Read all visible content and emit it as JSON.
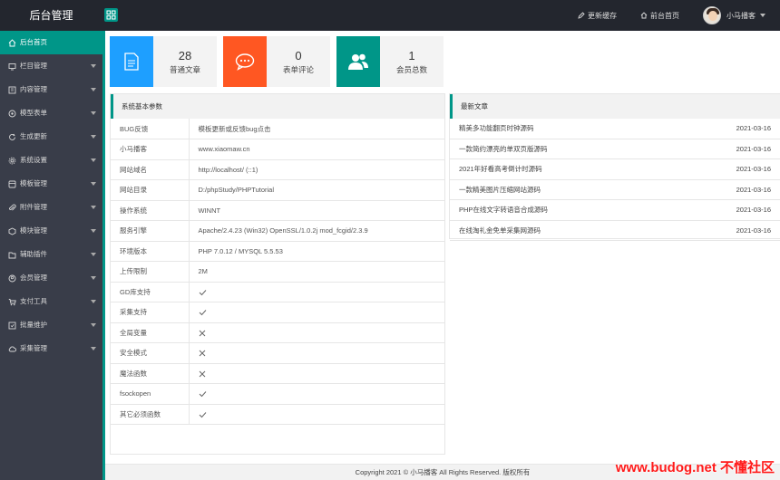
{
  "header": {
    "title": "后台管理",
    "update_cache": "更新缓存",
    "front_page": "前台首页",
    "username": "小马播客"
  },
  "sidebar": {
    "items": [
      {
        "label": "后台首页",
        "icon": "home-icon",
        "active": true
      },
      {
        "label": "栏目管理",
        "icon": "monitor-icon"
      },
      {
        "label": "内容管理",
        "icon": "content-icon"
      },
      {
        "label": "模型表单",
        "icon": "form-icon"
      },
      {
        "label": "生成更新",
        "icon": "refresh-icon"
      },
      {
        "label": "系统设置",
        "icon": "gear-icon"
      },
      {
        "label": "模板管理",
        "icon": "template-icon"
      },
      {
        "label": "附件管理",
        "icon": "attachment-icon"
      },
      {
        "label": "模块管理",
        "icon": "module-icon"
      },
      {
        "label": "辅助插件",
        "icon": "plugin-icon"
      },
      {
        "label": "会员管理",
        "icon": "member-icon"
      },
      {
        "label": "支付工具",
        "icon": "cart-icon"
      },
      {
        "label": "批量维护",
        "icon": "batch-icon"
      },
      {
        "label": "采集管理",
        "icon": "cloud-icon"
      }
    ]
  },
  "stats": [
    {
      "num": "28",
      "label": "普通文章",
      "color": "#1e9fff",
      "icon": "document-icon"
    },
    {
      "num": "0",
      "label": "表单评论",
      "color": "#ff5722",
      "icon": "chat-icon"
    },
    {
      "num": "1",
      "label": "会员总数",
      "color": "#009688",
      "icon": "users-icon"
    }
  ],
  "system": {
    "title": "系统基本参数",
    "rows": [
      {
        "k": "BUG反馈",
        "v": "模板更新或反馈bug点击",
        "t": "text"
      },
      {
        "k": "小马播客",
        "v": "www.xiaomaw.cn",
        "t": "text"
      },
      {
        "k": "网站域名",
        "v": "http://localhost/ (::1)",
        "t": "text"
      },
      {
        "k": "网站目录",
        "v": "D:/phpStudy/PHPTutorial",
        "t": "text"
      },
      {
        "k": "操作系统",
        "v": "WINNT",
        "t": "text"
      },
      {
        "k": "服务引擎",
        "v": "Apache/2.4.23 (Win32) OpenSSL/1.0.2j mod_fcgid/2.3.9",
        "t": "text"
      },
      {
        "k": "环境版本",
        "v": "PHP 7.0.12 / MYSQL 5.5.53",
        "t": "text"
      },
      {
        "k": "上传限制",
        "v": "2M",
        "t": "text"
      },
      {
        "k": "GD库支持",
        "v": "",
        "t": "check"
      },
      {
        "k": "采集支持",
        "v": "",
        "t": "check"
      },
      {
        "k": "全局变量",
        "v": "",
        "t": "cross"
      },
      {
        "k": "安全模式",
        "v": "",
        "t": "cross"
      },
      {
        "k": "魔法函数",
        "v": "",
        "t": "cross"
      },
      {
        "k": "fsockopen",
        "v": "",
        "t": "check"
      },
      {
        "k": "其它必须函数",
        "v": "",
        "t": "check"
      }
    ]
  },
  "articles": {
    "title": "最新文章",
    "items": [
      {
        "title": "精美多功能翻页时钟源码",
        "date": "2021-03-16"
      },
      {
        "title": "一款简约漂亮的单双页版源码",
        "date": "2021-03-16"
      },
      {
        "title": "2021年好看高考倒计时源码",
        "date": "2021-03-16"
      },
      {
        "title": "一款精美图片压缩网站源码",
        "date": "2021-03-16"
      },
      {
        "title": "PHP在线文字转语音合成源码",
        "date": "2021-03-16"
      },
      {
        "title": "在线淘礼金免单采集网源码",
        "date": "2021-03-16"
      }
    ]
  },
  "footer": "Copyright 2021 © 小马播客 All Rights Reserved. 版权所有",
  "watermark": "www.budog.net 不懂社区"
}
